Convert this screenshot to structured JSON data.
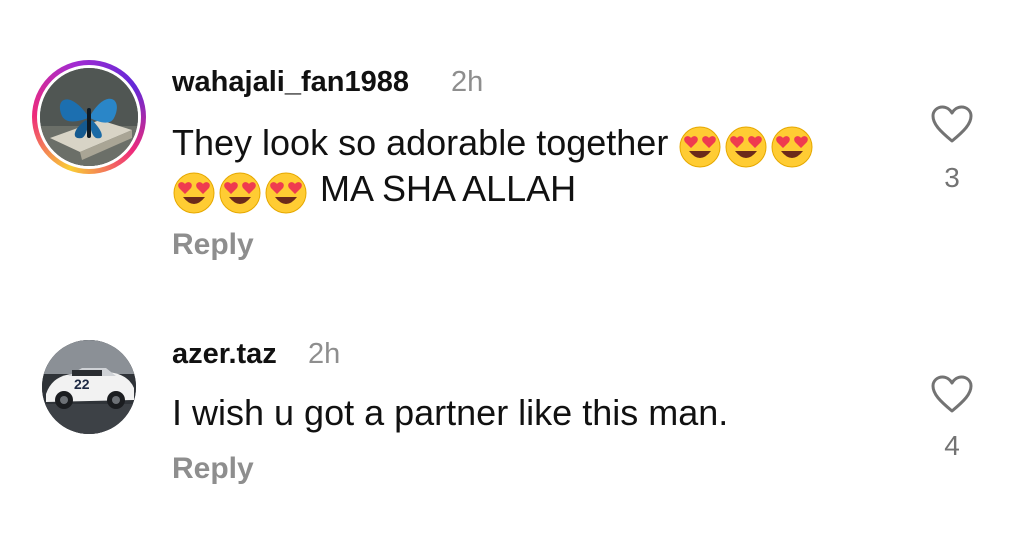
{
  "comments": [
    {
      "username": "wahajali_fan1988",
      "time": "2h",
      "text_line1": "They look so adorable together",
      "text_line2": "MA SHA ALLAH",
      "emoji": "smiling-face-with-heart-eyes",
      "emoji_count_line1": 3,
      "emoji_count_line2": 3,
      "reply_label": "Reply",
      "likes": "3",
      "avatar_icon": "butterfly-icon",
      "has_story_ring": true
    },
    {
      "username": "azer.taz",
      "time": "2h",
      "text_line1": "I wish u got a partner like this man.",
      "reply_label": "Reply",
      "likes": "4",
      "avatar_icon": "race-car-icon",
      "avatar_text": "22",
      "has_story_ring": false
    }
  ],
  "colors": {
    "text": "#111111",
    "secondary": "#8e8e8e",
    "ring_gradient": [
      "#f9ce34",
      "#ee2a7b",
      "#6228d7"
    ]
  }
}
